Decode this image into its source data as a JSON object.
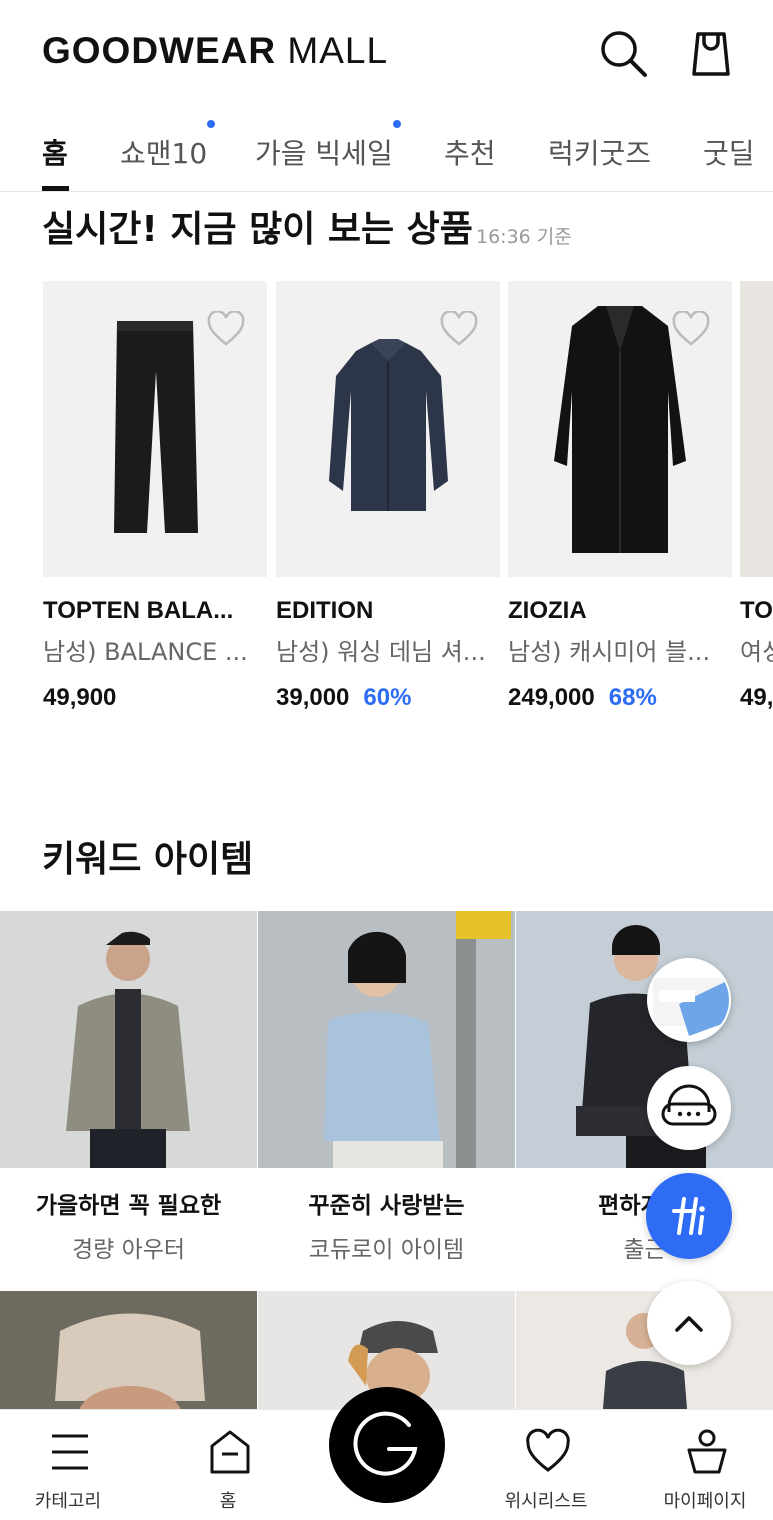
{
  "header": {
    "logo_bold": "GOODWEAR",
    "logo_light": "MALL"
  },
  "tabs": [
    {
      "label": "홈",
      "active": true,
      "dot": false
    },
    {
      "label": "쇼맨10",
      "active": false,
      "dot": true
    },
    {
      "label": "가을 빅세일",
      "active": false,
      "dot": true
    },
    {
      "label": "추천",
      "active": false,
      "dot": false
    },
    {
      "label": "럭키굿즈",
      "active": false,
      "dot": false
    },
    {
      "label": "굿딜",
      "active": false,
      "dot": false
    }
  ],
  "realtime": {
    "title": "실시간! 지금 많이 보는 상품",
    "time": "16:36 기준",
    "products": [
      {
        "brand": "TOPTEN BALA...",
        "name": "남성) BALANCE ...",
        "price": "49,900",
        "discount": ""
      },
      {
        "brand": "EDITION",
        "name": "남성) 워싱 데님 셔...",
        "price": "39,000",
        "discount": "60%"
      },
      {
        "brand": "ZIOZIA",
        "name": "남성) 캐시미어 블...",
        "price": "249,000",
        "discount": "68%"
      },
      {
        "brand": "TO",
        "name": "여성",
        "price": "49,",
        "discount": ""
      }
    ]
  },
  "keyword": {
    "title": "키워드 아이템",
    "items": [
      {
        "line1": "가을하면 꼭 필요한",
        "line2": "경량 아우터"
      },
      {
        "line1": "꾸준히 사랑받는",
        "line2": "코듀로이 아이템"
      },
      {
        "line1": "편하게 입",
        "line2": "출근"
      }
    ]
  },
  "fab": {
    "tag_label": "#"
  },
  "bottom_nav": [
    {
      "label": "카테고리"
    },
    {
      "label": "홈"
    },
    {
      "label": "위시리스트"
    },
    {
      "label": "마이페이지"
    }
  ],
  "colors": {
    "accent": "#2e6cf6",
    "text": "#111111",
    "muted": "#666666"
  }
}
